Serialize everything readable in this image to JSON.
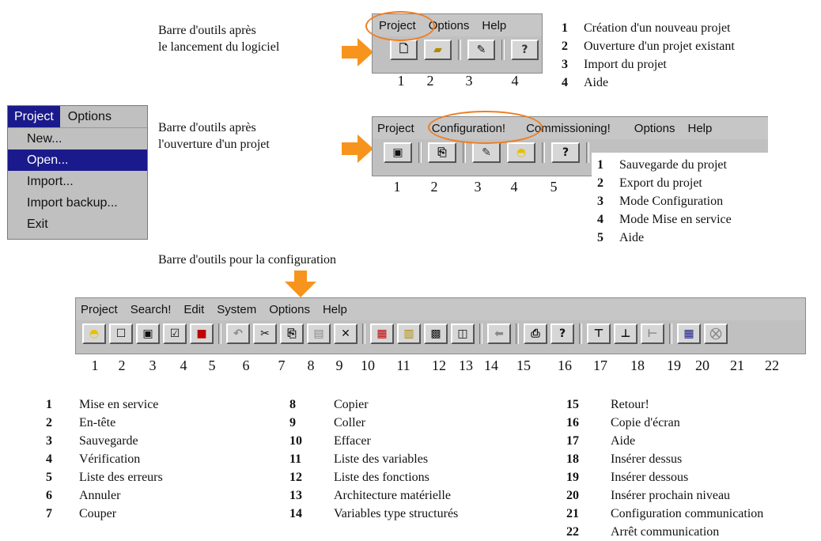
{
  "section1": {
    "caption_line1": "Barre d'outils après",
    "caption_line2": "le lancement du logiciel",
    "menu": [
      "Project",
      "Options",
      "Help"
    ],
    "numbers": [
      "1",
      "2",
      "3",
      "4"
    ],
    "legend": [
      {
        "n": "1",
        "text": "Création d'un nouveau projet"
      },
      {
        "n": "2",
        "text": "Ouverture d'un projet existant"
      },
      {
        "n": "3",
        "text": "Import du projet"
      },
      {
        "n": "4",
        "text": "Aide"
      }
    ]
  },
  "project_menu": {
    "bar": [
      "Project",
      "Options"
    ],
    "items": [
      "New...",
      "Open...",
      "Import...",
      "Import backup...",
      "Exit"
    ],
    "selected_index": 1
  },
  "section2": {
    "caption_line1": "Barre d'outils après",
    "caption_line2": "l'ouverture d'un projet",
    "menu": [
      "Project",
      "Configuration!",
      "Commissioning!",
      "Options",
      "Help"
    ],
    "numbers": [
      "1",
      "2",
      "3",
      "4",
      "5"
    ],
    "legend": [
      {
        "n": "1",
        "text": "Sauvegarde du projet"
      },
      {
        "n": "2",
        "text": "Export du projet"
      },
      {
        "n": "3",
        "text": "Mode Configuration"
      },
      {
        "n": "4",
        "text": "Mode Mise en service"
      },
      {
        "n": "5",
        "text": "Aide"
      }
    ]
  },
  "section3": {
    "caption": "Barre d'outils pour la configuration",
    "menu": [
      "Project",
      "Search!",
      "Edit",
      "System",
      "Options",
      "Help"
    ],
    "numbers": [
      "1",
      "2",
      "3",
      "4",
      "5",
      "6",
      "7",
      "8",
      "9",
      "10",
      "11",
      "12",
      "13",
      "14",
      "15",
      "16",
      "17",
      "18",
      "19",
      "20",
      "21",
      "22"
    ],
    "legend_col1": [
      {
        "n": "1",
        "text": "Mise en service"
      },
      {
        "n": "2",
        "text": "En-tête"
      },
      {
        "n": "3",
        "text": "Sauvegarde"
      },
      {
        "n": "4",
        "text": "Vérification"
      },
      {
        "n": "5",
        "text": "Liste des erreurs"
      },
      {
        "n": "6",
        "text": "Annuler"
      },
      {
        "n": "7",
        "text": "Couper"
      }
    ],
    "legend_col2": [
      {
        "n": "8",
        "text": "Copier"
      },
      {
        "n": "9",
        "text": "Coller"
      },
      {
        "n": "10",
        "text": "Effacer"
      },
      {
        "n": "11",
        "text": "Liste des variables"
      },
      {
        "n": "12",
        "text": "Liste des fonctions"
      },
      {
        "n": "13",
        "text": "Architecture matérielle"
      },
      {
        "n": "14",
        "text": "Variables type structurés"
      }
    ],
    "legend_col3": [
      {
        "n": "15",
        "text": "Retour!"
      },
      {
        "n": "16",
        "text": "Copie d'écran"
      },
      {
        "n": "17",
        "text": "Aide"
      },
      {
        "n": "18",
        "text": "Insérer dessus"
      },
      {
        "n": "19",
        "text": "Insérer dessous"
      },
      {
        "n": "20",
        "text": "Insérer prochain niveau"
      },
      {
        "n": "21",
        "text": "Configuration communication"
      },
      {
        "n": "22",
        "text": "Arrêt communication"
      }
    ]
  },
  "colors": {
    "accent": "#f7941d",
    "menu_selection": "#1a1a8c",
    "toolbar": "#c0c0c0"
  }
}
